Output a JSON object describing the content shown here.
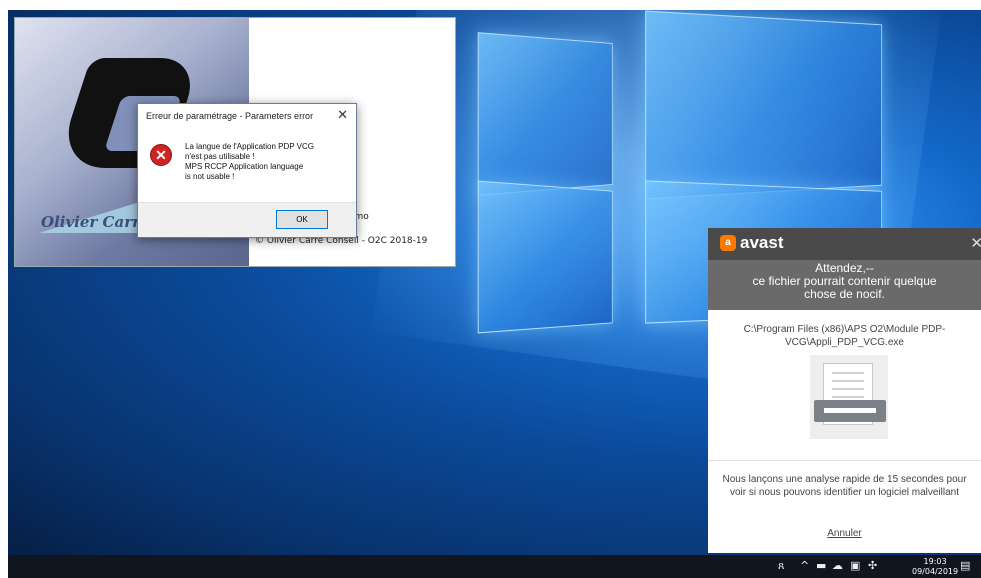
{
  "splash": {
    "logo_name": "Olivier Carré Conseil",
    "partial_line1": "G",
    "partial_line2": "CP",
    "partial_demo": "émo",
    "copyright": "© Olivier Carré Conseil - O2C 2018-19"
  },
  "error_dialog": {
    "title": "Erreur de paramétrage - Parameters error",
    "close_glyph": "✕",
    "icon_glyph": "✕",
    "message": "La langue de l'Application PDP VCG\nn'est pas utilisable !\nMPS RCCP Application language\nis not usable !",
    "ok_label": "OK"
  },
  "avast": {
    "brand": "avast",
    "logo_glyph": "a",
    "close_glyph": "✕",
    "warning_lines": [
      "Attendez,--",
      "ce fichier pourrait contenir quelque",
      "chose de nocif."
    ],
    "file_path": "C:\\Program Files (x86)\\APS O2\\Module PDP-VCG\\Appli_PDP_VCG.exe",
    "info": "Nous lançons une analyse rapide de 15 secondes pour voir si nous pouvons identifier un logiciel malveillant",
    "cancel_label": "Annuler",
    "colors": {
      "header": "#4a4a4a",
      "warning_bg": "#6a6a6a",
      "logo": "#ff7800"
    }
  },
  "taskbar": {
    "time": "19:03",
    "date": "09/04/2019",
    "tray_icons": [
      "people-icon",
      "chevron-up-icon",
      "battery-icon",
      "cloud-icon",
      "network-icon",
      "bluetooth-icon",
      "notification-icon"
    ]
  }
}
